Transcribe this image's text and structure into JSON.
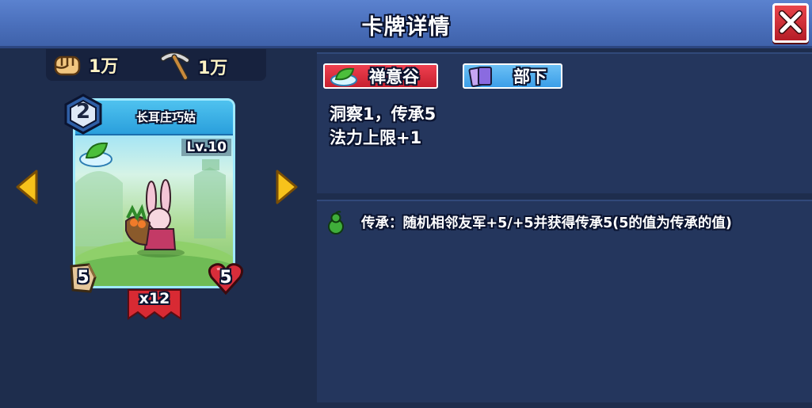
{
  "header": {
    "title": "卡牌详情"
  },
  "resources": [
    {
      "icon": "fist-icon",
      "value": "1万"
    },
    {
      "icon": "pickaxe-icon",
      "value": "1万"
    }
  ],
  "card": {
    "name": "长耳庄巧姑",
    "level": "Lv.10",
    "cost": "2",
    "attack": "5",
    "health": "5",
    "quantity": "x12"
  },
  "tags": [
    {
      "label": "禅意谷",
      "color": "#d8283a"
    },
    {
      "label": "部下",
      "color": "#3b9ee8"
    }
  ],
  "stats": [
    "洞察1，传承5",
    "法力上限+1"
  ],
  "skill": {
    "text": "传承：随机相邻友军+5/+5并获得传承5(5的值为传承的值)"
  },
  "colors": {
    "header": "#4a6fbb",
    "panel": "#24365d",
    "background": "#1e2d4d",
    "accent_gold": "#f6c21a"
  }
}
